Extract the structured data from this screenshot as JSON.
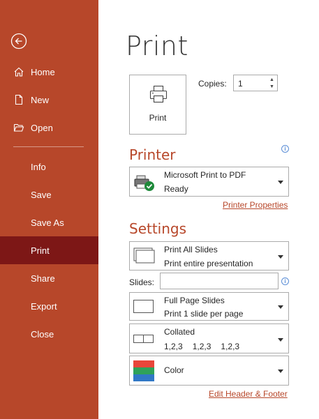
{
  "sidebar": {
    "items": [
      {
        "label": "Home",
        "icon": "home-icon"
      },
      {
        "label": "New",
        "icon": "new-document-icon"
      },
      {
        "label": "Open",
        "icon": "folder-open-icon"
      },
      {
        "label": "Info"
      },
      {
        "label": "Save"
      },
      {
        "label": "Save As"
      },
      {
        "label": "Print",
        "active": true
      },
      {
        "label": "Share"
      },
      {
        "label": "Export"
      },
      {
        "label": "Close"
      }
    ]
  },
  "main": {
    "title": "Print",
    "print_button": "Print",
    "copies": {
      "label": "Copies:",
      "value": "1"
    },
    "printer": {
      "title": "Printer",
      "name": "Microsoft Print to PDF",
      "status": "Ready",
      "properties_link": "Printer Properties"
    },
    "settings": {
      "title": "Settings",
      "range": {
        "primary": "Print All Slides",
        "secondary": "Print entire presentation"
      },
      "slides_label": "Slides:",
      "slides_value": "",
      "layout": {
        "primary": "Full Page Slides",
        "secondary": "Print 1 slide per page"
      },
      "collation": {
        "primary": "Collated",
        "secondary": [
          "1,2,3",
          "1,2,3",
          "1,2,3"
        ]
      },
      "color": {
        "primary": "Color"
      },
      "header_footer_link": "Edit Header & Footer"
    }
  },
  "colors": {
    "sidebar": "#b7472a",
    "active": "#7d1716",
    "accent": "#b7472a"
  }
}
